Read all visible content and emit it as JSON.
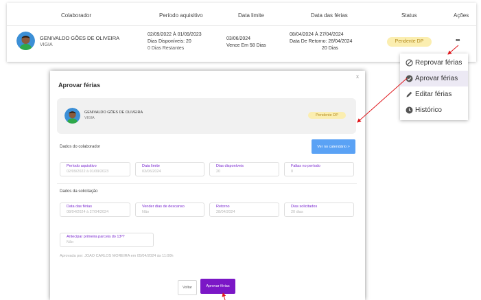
{
  "table": {
    "headers": [
      "Colaborador",
      "Período aquisitivo",
      "Data limite",
      "Data das férias",
      "Status",
      "Ações"
    ],
    "row": {
      "name": "GENIVALDO GÕES DE OLIVEIRA",
      "role": "VIGIA",
      "periodo": "02/09/2022 À 01/09/2023",
      "dias_disponiveis": "Dias Disponíveis: 20",
      "dias_restantes": "0 Dias Restantes",
      "data_limite": "03/06/2024",
      "vence": "Vence Em 58 Dias",
      "ferias": "08/04/2024 À 27/04/2024",
      "retorno": "Data De Retorno: 28/04/2024",
      "dias": "20 Dias",
      "status": "Pendente DP",
      "actions_icon": "•••"
    }
  },
  "menu": {
    "items": [
      {
        "label": "Reprovar férias",
        "icon": "ban-icon"
      },
      {
        "label": "Aprovar férias",
        "icon": "check-circle-icon"
      },
      {
        "label": "Editar férias",
        "icon": "pencil-icon"
      },
      {
        "label": "Histórico",
        "icon": "clock-icon"
      }
    ]
  },
  "modal": {
    "title": "Aprovar férias",
    "close": "x",
    "employee": {
      "name": "GENIVALDO GÕES DE OLIVEIRA",
      "role": "VIGIA",
      "status": "Pendente DP"
    },
    "section_colaborador": "Dados do colaborador",
    "calendar_button": "Ver no calendário >",
    "fields_colaborador": [
      {
        "label": "Período aquisitivo",
        "value": "02/09/2022 à 01/09/2023"
      },
      {
        "label": "Data limite",
        "value": "03/06/2024"
      },
      {
        "label": "Dias disponíveis",
        "value": "20"
      },
      {
        "label": "Faltas no período",
        "value": "0"
      }
    ],
    "section_solicitacao": "Dados da solicitação",
    "fields_solicitacao": [
      {
        "label": "Data das férias",
        "value": "08/04/2024 à 27/04/2024"
      },
      {
        "label": "Vender dias de descanso",
        "value": "Não"
      },
      {
        "label": "Retorno",
        "value": "28/04/2024"
      },
      {
        "label": "Dias solicitados",
        "value": "20 dias"
      }
    ],
    "antecipar": {
      "label": "Antecipar primeira parcela do 13º?",
      "value": "Não"
    },
    "approved_by": "Aprovada por: JOAO CARLOS MOREIRA em 05/04/2024 às 11:00h",
    "back_button": "Voltar",
    "approve_button": "Aprovar férias"
  },
  "colors": {
    "accent": "#7b17c6",
    "calendar_blue": "#5aa2f5",
    "badge_bg": "#fbeeb0",
    "arrow": "#e0161b"
  }
}
